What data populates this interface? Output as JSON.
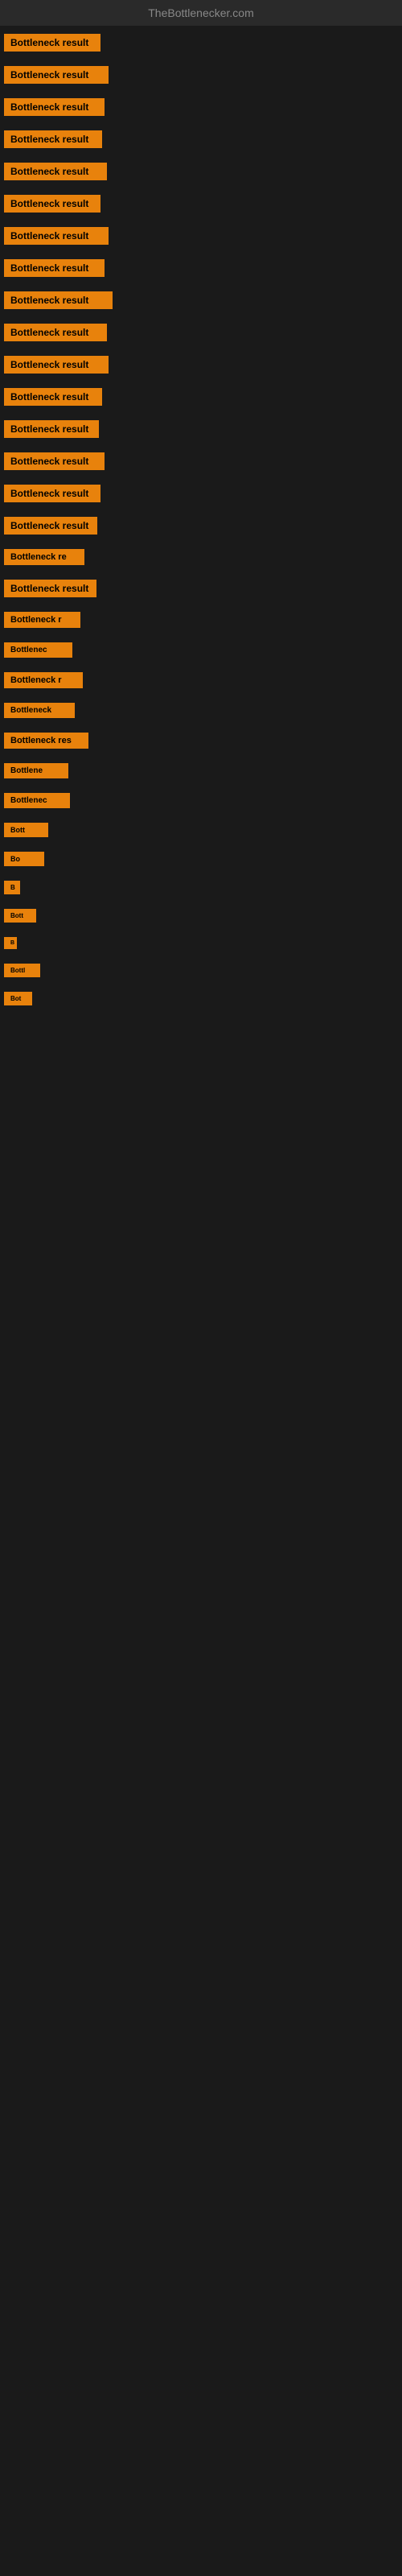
{
  "site": {
    "title": "TheBottlenecker.com"
  },
  "items": [
    {
      "id": 1,
      "label": "Bottleneck result",
      "class": "item-1"
    },
    {
      "id": 2,
      "label": "Bottleneck result",
      "class": "item-2"
    },
    {
      "id": 3,
      "label": "Bottleneck result",
      "class": "item-3"
    },
    {
      "id": 4,
      "label": "Bottleneck result",
      "class": "item-4"
    },
    {
      "id": 5,
      "label": "Bottleneck result",
      "class": "item-5"
    },
    {
      "id": 6,
      "label": "Bottleneck result",
      "class": "item-6"
    },
    {
      "id": 7,
      "label": "Bottleneck result",
      "class": "item-7"
    },
    {
      "id": 8,
      "label": "Bottleneck result",
      "class": "item-8"
    },
    {
      "id": 9,
      "label": "Bottleneck result",
      "class": "item-9"
    },
    {
      "id": 10,
      "label": "Bottleneck result",
      "class": "item-10"
    },
    {
      "id": 11,
      "label": "Bottleneck result",
      "class": "item-11"
    },
    {
      "id": 12,
      "label": "Bottleneck result",
      "class": "item-12"
    },
    {
      "id": 13,
      "label": "Bottleneck result",
      "class": "item-13"
    },
    {
      "id": 14,
      "label": "Bottleneck result",
      "class": "item-14"
    },
    {
      "id": 15,
      "label": "Bottleneck result",
      "class": "item-15"
    },
    {
      "id": 16,
      "label": "Bottleneck result",
      "class": "item-16"
    },
    {
      "id": 17,
      "label": "Bottleneck re",
      "class": "item-17"
    },
    {
      "id": 18,
      "label": "Bottleneck result",
      "class": "item-18"
    },
    {
      "id": 19,
      "label": "Bottleneck r",
      "class": "item-19"
    },
    {
      "id": 20,
      "label": "Bottlenec",
      "class": "item-20"
    },
    {
      "id": 21,
      "label": "Bottleneck r",
      "class": "item-21"
    },
    {
      "id": 22,
      "label": "Bottleneck",
      "class": "item-22"
    },
    {
      "id": 23,
      "label": "Bottleneck res",
      "class": "item-23"
    },
    {
      "id": 24,
      "label": "Bottlene",
      "class": "item-24"
    },
    {
      "id": 25,
      "label": "Bottlenec",
      "class": "item-25"
    },
    {
      "id": 26,
      "label": "Bott",
      "class": "item-26"
    },
    {
      "id": 27,
      "label": "Bo",
      "class": "item-27"
    },
    {
      "id": 28,
      "label": "B",
      "class": "item-28"
    },
    {
      "id": 29,
      "label": "Bott",
      "class": "item-29"
    },
    {
      "id": 30,
      "label": "B",
      "class": "item-30"
    },
    {
      "id": 31,
      "label": "Bottl",
      "class": "item-31"
    },
    {
      "id": 32,
      "label": "Bot",
      "class": "item-32"
    }
  ]
}
